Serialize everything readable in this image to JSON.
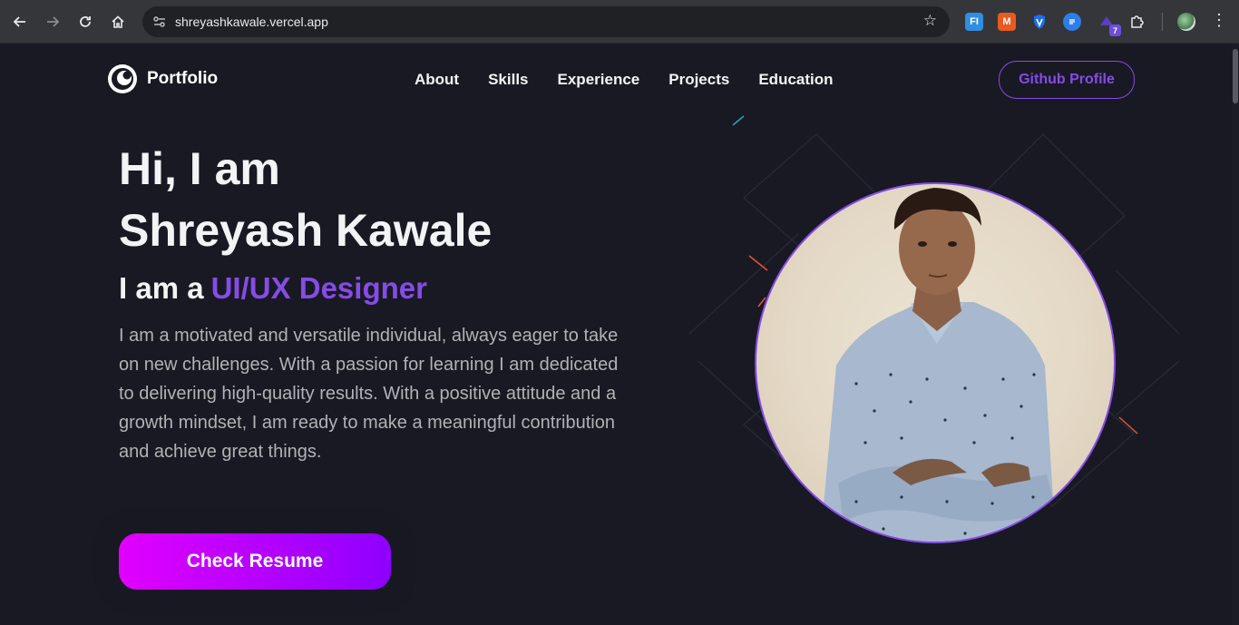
{
  "browser": {
    "url": "shreyashkawale.vercel.app",
    "icons": {
      "back": "back-arrow-icon",
      "forward": "forward-arrow-icon",
      "reload": "reload-icon",
      "home": "home-icon",
      "site_settings": "tune-icon",
      "bookmark": "star-icon",
      "extensions": "puzzle-icon",
      "menu": "kebab-menu-icon"
    },
    "extensions": [
      {
        "name": "ext-fi",
        "label": "FI",
        "color": "#2f8ee0"
      },
      {
        "name": "ext-m",
        "label": "M",
        "color": "#ea5a1e"
      },
      {
        "name": "ext-shield",
        "label": "",
        "color": "#1a6fe6"
      },
      {
        "name": "ext-doc",
        "label": "",
        "color": "#2d7de8"
      },
      {
        "name": "ext-badge",
        "label": "",
        "badge": "7",
        "color": "#6b4fd8"
      }
    ]
  },
  "site": {
    "logo": {
      "label": "Portfolio"
    },
    "nav": [
      "About",
      "Skills",
      "Experience",
      "Projects",
      "Education"
    ],
    "github_button": "Github Profile",
    "hero": {
      "line1": "Hi, I am",
      "line2": "Shreyash Kawale",
      "role_prefix": "I am a",
      "role": "UI/UX Designer",
      "description": "I am a motivated and versatile individual, always eager to take on new challenges. With a passion for learning I am dedicated to delivering high-quality results. With a positive attitude and a growth mindset, I am ready to make a meaningful contribution and achieve great things.",
      "resume_button": "Check Resume"
    },
    "colors": {
      "background": "#191924",
      "accent": "#854ce6",
      "text_primary": "#f2f3f4",
      "text_secondary": "#b1b2b3",
      "button_gradient_start": "#e100ff",
      "button_gradient_end": "#8e00ff"
    }
  }
}
